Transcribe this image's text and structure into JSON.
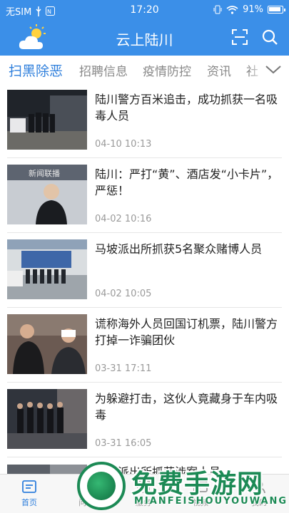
{
  "status_bar": {
    "carrier": "无SIM",
    "time": "17:20",
    "battery": "91%"
  },
  "header": {
    "title": "云上陆川",
    "weather_icon": "sun-cloud-icon",
    "scan_icon": "scan-icon",
    "search_icon": "search-icon",
    "background_color": "#3b8fe8"
  },
  "tabs": [
    {
      "label": "扫黑除恶",
      "active": true
    },
    {
      "label": "招聘信息",
      "active": false
    },
    {
      "label": "疫情防控",
      "active": false
    },
    {
      "label": "资讯",
      "active": false
    },
    {
      "label": "社",
      "active": false
    }
  ],
  "accent_color": "#2f7fdc",
  "news": [
    {
      "title": "陆川警方百米追击，成功抓获一名吸毒人员",
      "date": "04-10 10:13"
    },
    {
      "title": "陆川：严打“黄”、酒店发“小卡片”，严惩！",
      "date": "04-02 10:16",
      "thumb_caption": "新闻联播"
    },
    {
      "title": "马坡派出所抓获5名聚众赌博人员",
      "date": "04-02 10:05"
    },
    {
      "title": "谎称海外人员回国订机票，陆川警方打掉一诈骗团伙",
      "date": "03-31 17:11"
    },
    {
      "title": "为躲避打击，这伙人竟藏身于车内吸毒",
      "date": "03-31 16:05"
    },
    {
      "title": "陆城派出所抓获涉案人员",
      "date": ""
    }
  ],
  "bottom_nav": [
    {
      "label": "首页",
      "icon": "home-icon",
      "active": true
    },
    {
      "label": "问政",
      "icon": "chat-icon",
      "active": false
    },
    {
      "label": "服务",
      "icon": "service-icon",
      "active": false
    },
    {
      "label": "视频",
      "icon": "video-icon",
      "active": false
    },
    {
      "label": "我的",
      "icon": "user-icon",
      "active": false
    }
  ],
  "watermark": {
    "title": "免费手游网",
    "subtitle": "MIANFEISHOUYOUWANG"
  }
}
